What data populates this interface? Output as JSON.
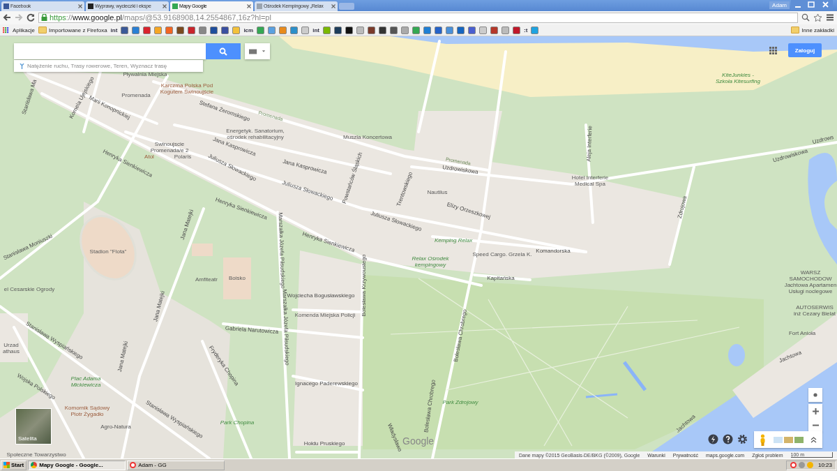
{
  "browser": {
    "tabs": [
      {
        "title": "Facebook",
        "selected": false,
        "color": "#3b5998"
      },
      {
        "title": "Wyprawy, wycieczki i ekspe",
        "selected": false,
        "color": "#222222"
      },
      {
        "title": "Mapy Google",
        "selected": true,
        "color": "#34a853"
      },
      {
        "title": "Ośrodek Kempingowy „Relax",
        "selected": false,
        "color": "#9aa4b0"
      }
    ],
    "user": "Adam",
    "address": {
      "scheme": "https",
      "separator": "://",
      "host": "www.google.pl",
      "path": "/maps/@53.9168908,14.2554867,16z?hl=pl"
    },
    "bookmarks": [
      {
        "kind": "apps",
        "label": "Aplikacje"
      },
      {
        "kind": "folder",
        "label": "Importowane z Firefoxa"
      },
      {
        "kind": "text",
        "label": "int"
      },
      {
        "kind": "icon",
        "color": "#3b5998"
      },
      {
        "kind": "icon",
        "color": "#2a7fd4"
      },
      {
        "kind": "icon",
        "color": "#d9232e"
      },
      {
        "kind": "icon",
        "color": "#f5a623"
      },
      {
        "kind": "icon",
        "color": "#f26522"
      },
      {
        "kind": "icon",
        "color": "#7a4a1e"
      },
      {
        "kind": "icon",
        "color": "#c9242b"
      },
      {
        "kind": "icon",
        "color": "#888888"
      },
      {
        "kind": "icon",
        "color": "#1f4e9c"
      },
      {
        "kind": "icon",
        "color": "#3a4fa0"
      },
      {
        "kind": "icon",
        "color": "#f3c13a"
      },
      {
        "kind": "text",
        "label": "icm"
      },
      {
        "kind": "icon",
        "color": "#34a853"
      },
      {
        "kind": "icon",
        "color": "#5aa0e0"
      },
      {
        "kind": "icon",
        "color": "#e88b1d"
      },
      {
        "kind": "icon",
        "color": "#2c8fc9"
      },
      {
        "kind": "icon",
        "color": "#cccccc"
      },
      {
        "kind": "text",
        "label": "int"
      },
      {
        "kind": "icon",
        "color": "#7ab800"
      },
      {
        "kind": "icon",
        "color": "#1d3c5a"
      },
      {
        "kind": "icon",
        "color": "#111111"
      },
      {
        "kind": "icon",
        "color": "#bbbbbb"
      },
      {
        "kind": "icon",
        "color": "#7a3a2a"
      },
      {
        "kind": "icon",
        "color": "#333333"
      },
      {
        "kind": "icon",
        "color": "#555555"
      },
      {
        "kind": "icon",
        "color": "#aaaaaa"
      },
      {
        "kind": "icon",
        "color": "#34a853"
      },
      {
        "kind": "icon",
        "color": "#1f7fd4"
      },
      {
        "kind": "icon",
        "color": "#2563c9"
      },
      {
        "kind": "icon",
        "color": "#4a90d9"
      },
      {
        "kind": "icon",
        "color": "#1565c0"
      },
      {
        "kind": "icon",
        "color": "#4a5fd0"
      },
      {
        "kind": "icon",
        "color": "#cccccc"
      },
      {
        "kind": "icon",
        "color": "#b5372a"
      },
      {
        "kind": "icon",
        "color": "#bbbbbb"
      },
      {
        "kind": "icon",
        "color": "#c0182a"
      },
      {
        "kind": "text",
        "label": ":t"
      },
      {
        "kind": "icon",
        "color": "#1fa3e0"
      },
      {
        "kind": "other",
        "label": "Inne zakładki"
      }
    ]
  },
  "map": {
    "search": {
      "suggestion": "Natężenie ruchu, Trasy rowerowe, Teren, Wyznacz trasę"
    },
    "sign_in": "Zaloguj",
    "labels": [
      {
        "text": "Pływalnia Miejska",
        "kind": "poi"
      },
      {
        "lines": [
          "Karczma Polska Pod",
          "Kogutem Świnoujście"
        ],
        "kind": "business"
      },
      {
        "text": "Promenada",
        "kind": "poi"
      },
      {
        "text": "Stefana Żeromskiego",
        "kind": "street"
      },
      {
        "text": "Promenada",
        "kind": "path"
      },
      {
        "text": "Marii Konopnickiej",
        "kind": "street"
      },
      {
        "text": "Kornela Ujejskiego",
        "kind": "street"
      },
      {
        "text": "Stanisława Ma",
        "kind": "street"
      },
      {
        "lines": [
          "Energetyk. Sanatorium,",
          "ośrodek rehabilitacyjny"
        ],
        "kind": "poi"
      },
      {
        "text": "Muszla Koncertowa",
        "kind": "poi"
      },
      {
        "lines": [
          "Swinoujscie",
          "Promenada/e 2"
        ],
        "kind": "place"
      },
      {
        "text": "Atol",
        "kind": "business"
      },
      {
        "text": "Polaris",
        "kind": "poi"
      },
      {
        "text": "Jana Kasprowicza",
        "kind": "street"
      },
      {
        "text": "Jana Kasprowicza",
        "kind": "street"
      },
      {
        "text": "Juliusza Słowackiego",
        "kind": "street"
      },
      {
        "text": "Juliusza Słowackiego",
        "kind": "street"
      },
      {
        "text": "Juliusza Słowackiego",
        "kind": "street"
      },
      {
        "text": "Henryka Sienkiewicza",
        "kind": "street"
      },
      {
        "text": "Henryka Sienkiewicza",
        "kind": "street"
      },
      {
        "text": "Henryka Sienkiewicza",
        "kind": "street"
      },
      {
        "text": "Powstańców Śląskich",
        "kind": "street"
      },
      {
        "text": "Promenada",
        "kind": "path"
      },
      {
        "text": "Uzdrowiskowa",
        "kind": "street"
      },
      {
        "text": "Trentowskiego",
        "kind": "street"
      },
      {
        "text": "Nautilus",
        "kind": "poi"
      },
      {
        "text": "Elizy Orzeszkowej",
        "kind": "street"
      },
      {
        "text": "Kemping Relax",
        "kind": "green"
      },
      {
        "lines": [
          "Relax  Ośrodek",
          "kempingowy"
        ],
        "kind": "green"
      },
      {
        "text": "Speed Cargo. Grzela K.",
        "kind": "place"
      },
      {
        "text": "Komandorska",
        "kind": "street"
      },
      {
        "text": "Kapitańska",
        "kind": "street"
      },
      {
        "text": "Aleja Interferie",
        "kind": "street"
      },
      {
        "lines": [
          "Hotel Interferie",
          "Medical Spa"
        ],
        "kind": "poi"
      },
      {
        "text": "Uzdrowiskowa",
        "kind": "street"
      },
      {
        "text": "Uzdrows",
        "kind": "street"
      },
      {
        "text": "Zdrojowa",
        "kind": "street"
      },
      {
        "lines": [
          "KiteJunkies -",
          "Szkoła Kitesurfing"
        ],
        "kind": "green"
      },
      {
        "text": "Stanisława Moniuszki",
        "kind": "street"
      },
      {
        "text": "Stadion \"Flota\"",
        "kind": "poi"
      },
      {
        "text": "Jana Matejki",
        "kind": "street"
      },
      {
        "text": "Jana Matejki",
        "kind": "street"
      },
      {
        "text": "Jana Matejki",
        "kind": "street"
      },
      {
        "text": "Marszałka Józefa Piłsudskiego",
        "kind": "street"
      },
      {
        "text": "Marszałka Józefa Piłsudskiego",
        "kind": "street"
      },
      {
        "text": "Amfiteatr",
        "kind": "poi"
      },
      {
        "text": "Boisko",
        "kind": "poi"
      },
      {
        "text": "Wojciecha Bogusławskiego",
        "kind": "street"
      },
      {
        "text": "Bolesława Krzywoustego",
        "kind": "street"
      },
      {
        "text": "Komenda Miejska Policji",
        "kind": "poi"
      },
      {
        "text": "el Cesarskie Ogrody",
        "kind": "poi"
      },
      {
        "text": "Gabriela Narutowicza",
        "kind": "street"
      },
      {
        "text": "Stanisława Wyspiańskiego",
        "kind": "street"
      },
      {
        "lines": [
          "Urzad",
          "athaus"
        ],
        "kind": "place"
      },
      {
        "text": "Fryderyka Chopina",
        "kind": "street"
      },
      {
        "lines": [
          "Plac Adama",
          "Mickiewicza"
        ],
        "kind": "green"
      },
      {
        "text": "Ignacego Paderewskiego",
        "kind": "street"
      },
      {
        "text": "Wojska Polskiego",
        "kind": "street"
      },
      {
        "text": "Stanisława Wyspiańskiego",
        "kind": "street"
      },
      {
        "lines": [
          "Komornik Sądowy",
          "Piotr Żygadło"
        ],
        "kind": "business"
      },
      {
        "text": "Agro-Natura",
        "kind": "place"
      },
      {
        "text": "Park Chopina",
        "kind": "green"
      },
      {
        "text": "Społeczne Towarzystwo",
        "kind": "place"
      },
      {
        "text": "Hołdu Pruskiego",
        "kind": "street"
      },
      {
        "text": "Władysławo",
        "kind": "street"
      },
      {
        "text": "Bolesława Chrobrego",
        "kind": "street"
      },
      {
        "text": "Bolesława Chrobrego",
        "kind": "street"
      },
      {
        "text": "Park Zdrojowy",
        "kind": "green"
      },
      {
        "lines": [
          "WARSZ",
          "SAMOCHODOW",
          "Jachtowa Apartamen",
          "Usługi noclegowe"
        ],
        "kind": "place"
      },
      {
        "lines": [
          "AUTOSERWIS",
          "inż Cezary Bielat"
        ],
        "kind": "place"
      },
      {
        "text": "Fort Anioła",
        "kind": "place"
      },
      {
        "text": "Jachtowa",
        "kind": "street"
      },
      {
        "text": "Jachtowa",
        "kind": "street"
      }
    ],
    "logo": "Google",
    "satellite_label": "Satelita",
    "attribution": "Dane mapy ©2015 GeoBasis-DE/BKG (©2009), Google",
    "links": [
      "Warunki",
      "Prywatność",
      "maps.google.com",
      "Zgłoś problem"
    ],
    "scale": "100 m"
  },
  "taskbar": {
    "start": "Start",
    "items": [
      {
        "title": "Mapy Google - Google...",
        "selected": true,
        "kind": "chrome"
      },
      {
        "title": "Adam - GG",
        "selected": false,
        "kind": "gg"
      }
    ],
    "clock": "10:23"
  }
}
